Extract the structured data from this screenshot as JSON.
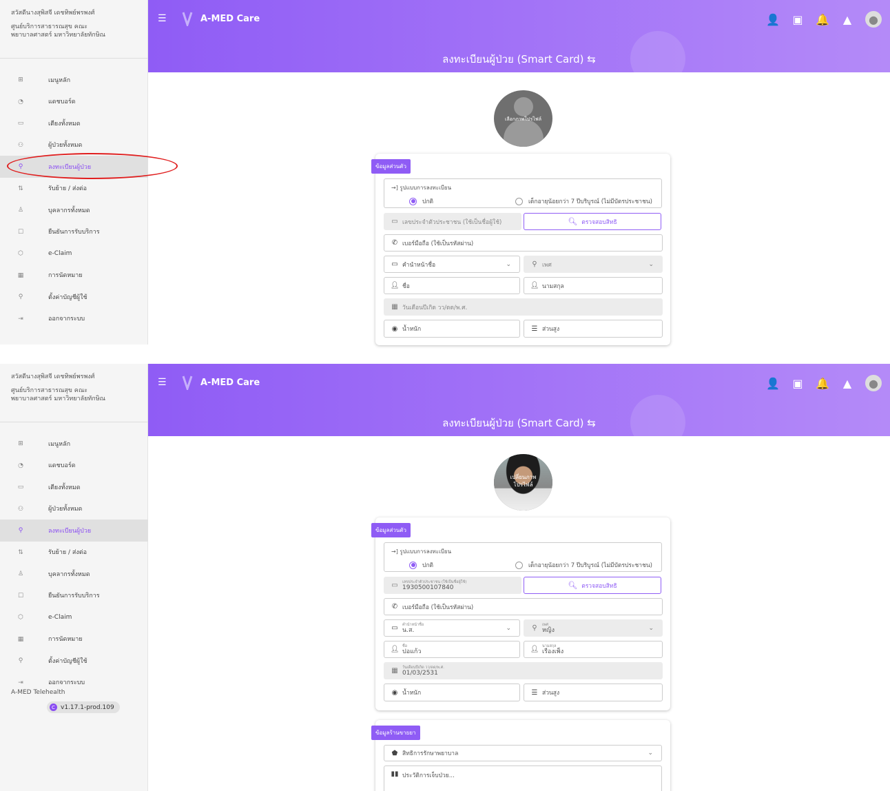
{
  "sidebar": {
    "hospital_line1": "สวัสดีนางสุพิสจี เดชทิพย์พรพงศ์",
    "hospital_line2": "ศูนย์บริการสาธารณสุข คณะ",
    "hospital_line3": "พยาบาลศาสตร์ มหาวิทยาลัยทักษิณ",
    "items": [
      {
        "label": "เมนูหลัก",
        "icon": "grid-icon"
      },
      {
        "label": "แดชบอร์ด",
        "icon": "pie-chart-icon"
      },
      {
        "label": "เตียงทั้งหมด",
        "icon": "bed-icon"
      },
      {
        "label": "ผู้ป่วยทั้งหมด",
        "icon": "users-icon"
      },
      {
        "label": "ลงทะเบียนผู้ป่วย",
        "icon": "user-plus-icon"
      },
      {
        "label": "รับย้าย / ส่งต่อ",
        "icon": "transfer-icon"
      },
      {
        "label": "บุคลากรทั้งหมด",
        "icon": "badge-icon"
      },
      {
        "label": "ยืนยันการรับบริการ",
        "icon": "edit-icon"
      },
      {
        "label": "e-Claim",
        "icon": "shield-icon"
      },
      {
        "label": "การนัดหมาย",
        "icon": "calendar-icon"
      },
      {
        "label": "ตั้งค่าบัญชีผู้ใช้",
        "icon": "user-icon"
      },
      {
        "label": "ออกจากระบบ",
        "icon": "logout-icon"
      }
    ],
    "active_index": 4,
    "telehealth_label": "A-MED Telehealth",
    "version": "v1.17.1-prod.109"
  },
  "header": {
    "brand": "A-MED Care",
    "page_title": "ลงทะเบียนผู้ป่วย (Smart Card) ⇆"
  },
  "profile": {
    "choose_photo": "เลือกภาพโปรไฟล์",
    "change_photo_line1": "เปลี่ยนภาพ",
    "change_photo_line2": "โปรไฟล์"
  },
  "personal": {
    "section_label": "ข้อมูลส่วนตัว",
    "reg_type_title": "→] รูปแบบการลงทะเบียน",
    "reg_normal": "ปกติ",
    "reg_child": "เด็กอายุน้อยกว่า 7 ปีบริบูรณ์ (ไม่มีบัตรประชาชน)",
    "id_placeholder": "เลขประจำตัวประชาชน (ใช้เป็นชื่อผู้ใช้)",
    "id_value": "1930500107840",
    "check_rights": "ตรวจสอบสิทธิ",
    "phone_placeholder": "เบอร์มือถือ (ใช้เป็นรหัสผ่าน)",
    "prefix_placeholder": "คำนำหน้าชื่อ",
    "prefix_value": "น.ส.",
    "gender_placeholder": "เพศ",
    "gender_value": "หญิง",
    "first_name_placeholder": "ชื่อ",
    "first_name_value": "ปอแก้ว",
    "last_name_placeholder": "นามสกุล",
    "last_name_value": "เรืองเพ็ง",
    "dob_placeholder": "วันเดือนปีเกิด วว/ดด/พ.ศ.",
    "dob_value": "01/03/2531",
    "weight_placeholder": "น้ำหนัก",
    "height_placeholder": "ส่วนสูง"
  },
  "pharmacy": {
    "section_label": "ข้อมูลร้านขายยา",
    "rights_placeholder": "สิทธิการรักษาพยาบาล",
    "history_placeholder": "ประวัติการเจ็บป่วย..."
  },
  "colors": {
    "accent": "#8f5cf5",
    "highlight_oval": "#e01e1e"
  }
}
